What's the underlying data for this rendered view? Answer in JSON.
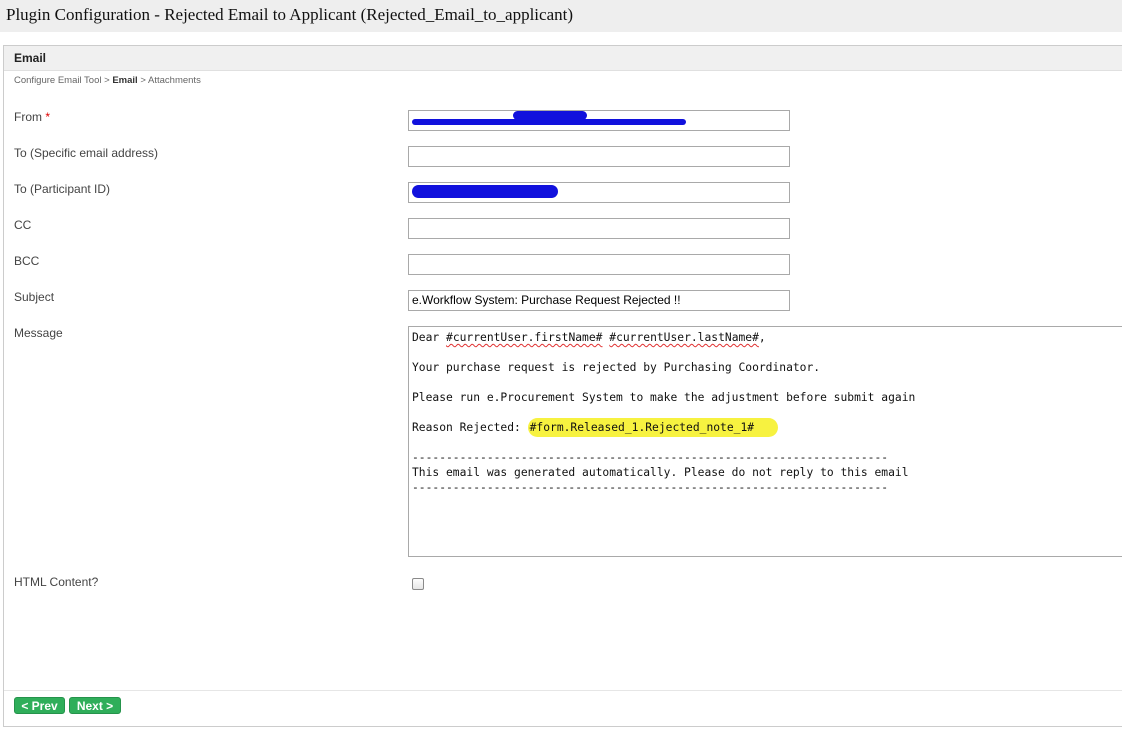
{
  "window": {
    "title": "Plugin Configuration - Rejected Email to Applicant (Rejected_Email_to_applicant)"
  },
  "panel": {
    "header": "Email",
    "breadcrumb": {
      "step1": "Configure Email Tool",
      "sep": ">",
      "current": "Email",
      "step3": "Attachments"
    }
  },
  "form": {
    "from": {
      "label": "From",
      "required_mark": "*",
      "value": ""
    },
    "to_email": {
      "label": "To (Specific email address)",
      "value": ""
    },
    "to_participant": {
      "label": "To (Participant ID)",
      "value": ""
    },
    "cc": {
      "label": "CC",
      "value": ""
    },
    "bcc": {
      "label": "BCC",
      "value": ""
    },
    "subject": {
      "label": "Subject",
      "value": "e.Workflow System: Purchase Request Rejected !!"
    },
    "message": {
      "label": "Message",
      "line1_prefix": "Dear ",
      "line1_var1": "#currentUser.firstName#",
      "line1_space": " ",
      "line1_var2": "#currentUser.lastName#",
      "line1_suffix": ",",
      "line2": "Your purchase request is rejected by Purchasing Coordinator.",
      "line3": "Please run e.Procurement System to make the adjustment before submit again",
      "line4_prefix": "Reason Rejected: ",
      "line4_var": "#form.Released_1.Rejected_note_1#",
      "divider": "----------------------------------------------------------------------",
      "footer_note": "This email was generated automatically. Please do not reply to this email"
    },
    "html_content": {
      "label": "HTML Content?",
      "checked": false
    }
  },
  "buttons": {
    "prev": "< Prev",
    "next": "Next >"
  },
  "colors": {
    "button_green": "#2fae5a",
    "highlight_yellow": "#f7f240",
    "redaction_blue": "#1111dd"
  }
}
